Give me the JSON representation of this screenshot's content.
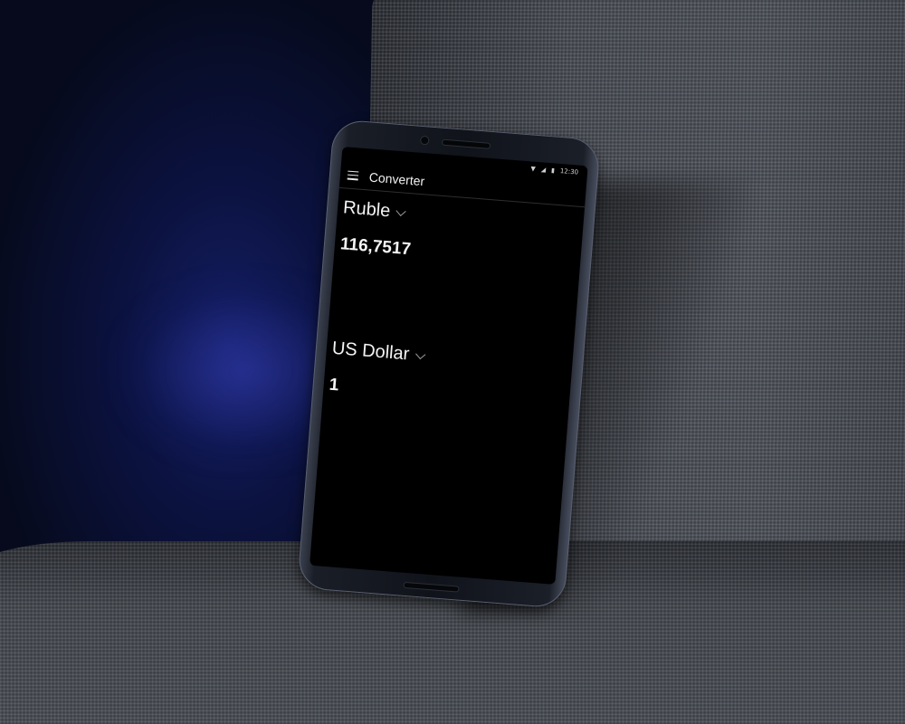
{
  "status_bar": {
    "wifi_icon": "wifi-icon",
    "signal_icon": "cellular-signal-icon",
    "battery_icon": "battery-icon",
    "time": "12:30"
  },
  "app_bar": {
    "menu_icon": "menu-icon",
    "title": "Converter"
  },
  "from_currency": {
    "label": "Ruble",
    "amount": "116,7517"
  },
  "to_currency": {
    "label": "US Dollar",
    "amount": "1"
  },
  "colors": {
    "screen_background": "#000000",
    "text": "#f4f4f4",
    "chevron": "#9a9a9a"
  }
}
